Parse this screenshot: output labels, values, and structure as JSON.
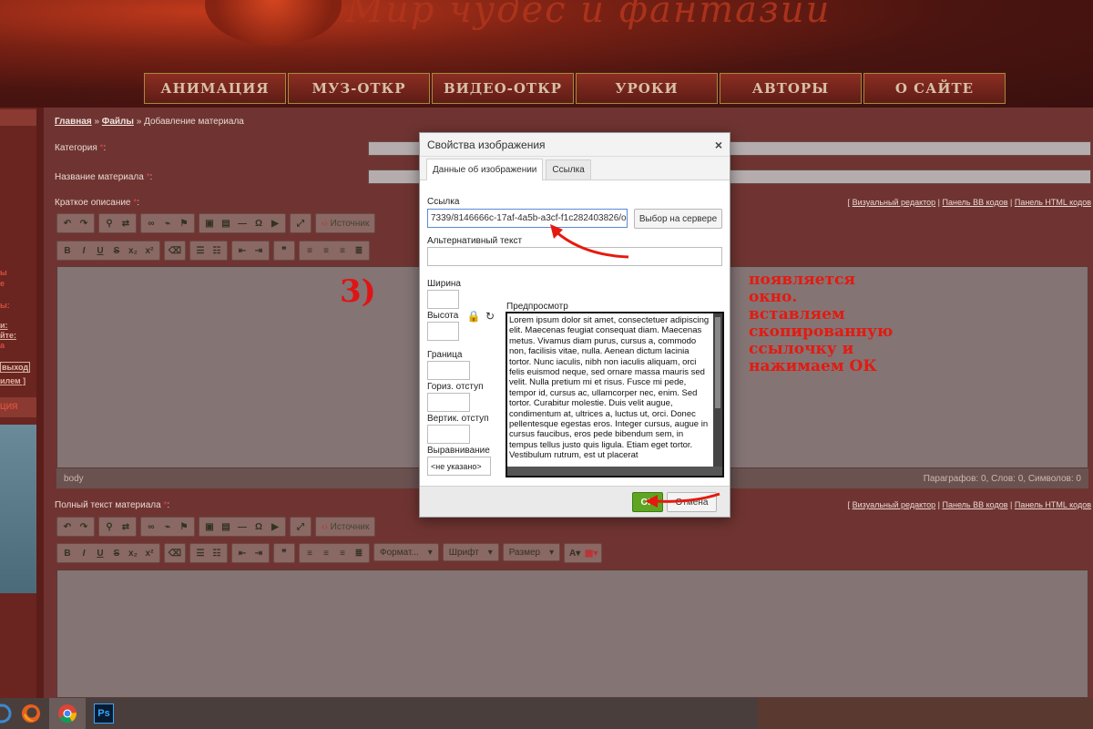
{
  "site": {
    "title": "Мир чудес и фантазии",
    "nav": [
      "АНИМАЦИЯ",
      "МУЗ-ОТКР",
      "ВИДЕО-ОТКР",
      "УРОКИ",
      "АВТОРЫ",
      "О САЙТЕ"
    ]
  },
  "breadcrumb": {
    "home": "Главная",
    "sep": "»",
    "files": "Файлы",
    "current": "Добавление материала"
  },
  "form": {
    "category_label": "Категория",
    "name_label": "Название материала",
    "short_label": "Краткое описание",
    "full_label": "Полный текст материала",
    "required_mark": "*",
    "colon": ":"
  },
  "editor_links": {
    "visual": "Визуальный редактор",
    "bb": "Панель BB кодов",
    "html": "Панель HTML кодов"
  },
  "editor": {
    "source_label": "Источник",
    "format_label": "Формат...",
    "font_label": "Шрифт",
    "size_label": "Размер",
    "status_path": "body",
    "status_counts": "Параграфов: 0, Слов: 0, Символов: 0"
  },
  "left_panel": {
    "l1": "ы",
    "l2": "е",
    "l3": "ы:",
    "l4": "и:",
    "l5": "йте:",
    "l6": "а",
    "l7": "выход",
    "l8": "илем ]",
    "l9": "ЦИЯ"
  },
  "dialog": {
    "title": "Свойства изображения",
    "close_symbol": "×",
    "tabs": [
      "Данные об изображении",
      "Ссылка"
    ],
    "url_label": "Ссылка",
    "url_value": "7339/8146666c-17af-4a5b-a3cf-f1c282403826/orig",
    "browse_label": "Выбор на сервере",
    "alt_label": "Альтернативный текст",
    "alt_value": "",
    "width_label": "Ширина",
    "height_label": "Высота",
    "border_label": "Граница",
    "hspace_label": "Гориз. отступ",
    "vspace_label": "Вертик. отступ",
    "align_label": "Выравнивание",
    "align_value": "<не указано>",
    "preview_label": "Предпросмотр",
    "preview_text": "Lorem ipsum dolor sit amet, consectetuer adipiscing elit. Maecenas feugiat consequat diam. Maecenas metus. Vivamus diam purus, cursus a, commodo non, facilisis vitae, nulla. Aenean dictum lacinia tortor. Nunc iaculis, nibh non iaculis aliquam, orci felis euismod neque, sed ornare massa mauris sed velit. Nulla pretium mi et risus. Fusce mi pede, tempor id, cursus ac, ullamcorper nec, enim. Sed tortor. Curabitur molestie. Duis velit augue, condimentum at, ultrices a, luctus ut, orci. Donec pellentesque egestas eros. Integer cursus, augue in cursus faucibus, eros pede bibendum sem, in tempus tellus justo quis ligula. Etiam eget tortor. Vestibulum rutrum, est ut placerat",
    "ok_label": "OK",
    "cancel_label": "Отмена"
  },
  "annotation": {
    "step": "3)",
    "lines": [
      "появляется",
      "окно.",
      "вставляем",
      "скопированную",
      "ссылочку и",
      "нажимаем ОК"
    ],
    "color": "#e41a10"
  },
  "taskbar": {
    "apps": [
      "ie-icon",
      "firefox-icon",
      "chrome-icon",
      "photoshop-icon"
    ],
    "ps_label": "Ps"
  },
  "colors": {
    "ok_green": "#5fa521",
    "annotation_red": "#e41a10",
    "overlay_tint": "#6f3431"
  }
}
